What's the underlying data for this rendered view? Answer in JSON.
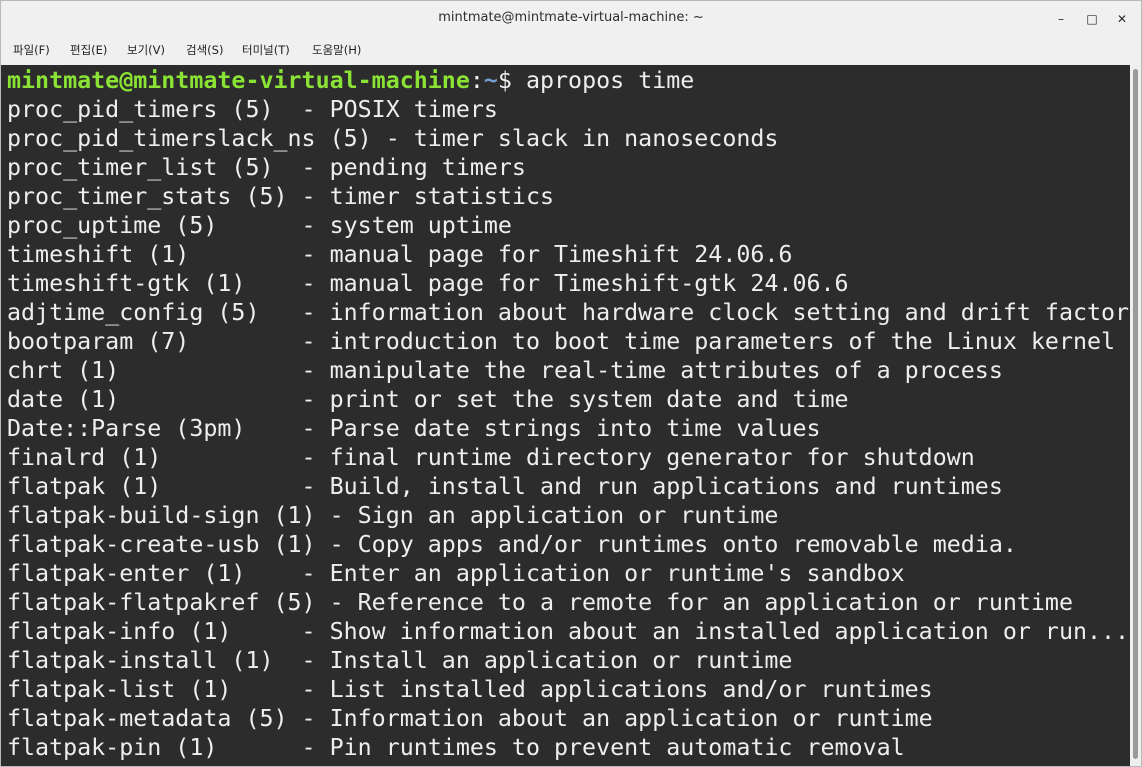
{
  "window": {
    "title": "mintmate@mintmate-virtual-machine: ~",
    "controls": {
      "minimize": "–",
      "maximize": "□",
      "close": "✕"
    }
  },
  "menu": [
    "파일(F)",
    "편집(E)",
    "보기(V)",
    "검색(S)",
    "터미널(T)",
    "도움말(H)"
  ],
  "prompt": {
    "user_host": "mintmate@mintmate-virtual-machine",
    "colon": ":",
    "path": "~",
    "symbol": "$ ",
    "command": "apropos time"
  },
  "output": [
    "proc_pid_timers (5)  - POSIX timers",
    "proc_pid_timerslack_ns (5) - timer slack in nanoseconds",
    "proc_timer_list (5)  - pending timers",
    "proc_timer_stats (5) - timer statistics",
    "proc_uptime (5)      - system uptime",
    "timeshift (1)        - manual page for Timeshift 24.06.6",
    "timeshift-gtk (1)    - manual page for Timeshift-gtk 24.06.6",
    "adjtime_config (5)   - information about hardware clock setting and drift factor",
    "bootparam (7)        - introduction to boot time parameters of the Linux kernel",
    "chrt (1)             - manipulate the real-time attributes of a process",
    "date (1)             - print or set the system date and time",
    "Date::Parse (3pm)    - Parse date strings into time values",
    "finalrd (1)          - final runtime directory generator for shutdown",
    "flatpak (1)          - Build, install and run applications and runtimes",
    "flatpak-build-sign (1) - Sign an application or runtime",
    "flatpak-create-usb (1) - Copy apps and/or runtimes onto removable media.",
    "flatpak-enter (1)    - Enter an application or runtime's sandbox",
    "flatpak-flatpakref (5) - Reference to a remote for an application or runtime",
    "flatpak-info (1)     - Show information about an installed application or run...",
    "flatpak-install (1)  - Install an application or runtime",
    "flatpak-list (1)     - List installed applications and/or runtimes",
    "flatpak-metadata (5) - Information about an application or runtime",
    "flatpak-pin (1)      - Pin runtimes to prevent automatic removal"
  ],
  "colors": {
    "terminal_bg": "#2c2c2c",
    "text": "#eeeeee",
    "prompt_user": "#8ae234",
    "prompt_path": "#729fcf"
  }
}
